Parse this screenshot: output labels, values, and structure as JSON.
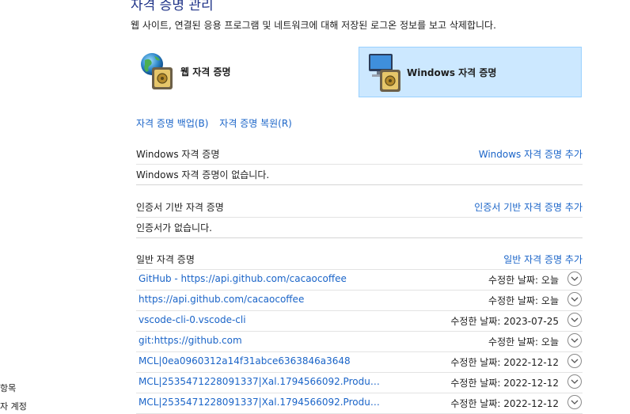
{
  "page": {
    "title": "자격 증명 관리",
    "description": "웹 사이트, 연결된 응용 프로그램 및 네트워크에 대해 저장된 로그온 정보를 보고 삭제합니다."
  },
  "tiles": {
    "web": {
      "label": "웹 자격 증명",
      "icon": "web-credential-icon"
    },
    "windows": {
      "label": "Windows 자격 증명",
      "icon": "windows-credential-icon",
      "selected": true
    }
  },
  "links": {
    "backup": "자격 증명 백업(B)",
    "restore": "자격 증명 복원(R)"
  },
  "sections": {
    "windows": {
      "heading": "Windows 자격 증명",
      "add": "Windows 자격 증명 추가",
      "empty": "Windows 자격 증명이 없습니다."
    },
    "certificate": {
      "heading": "인증서 기반 자격 증명",
      "add": "인증서 기반 자격 증명 추가",
      "empty": "인증서가 없습니다."
    },
    "generic": {
      "heading": "일반 자격 증명",
      "add": "일반 자격 증명 추가"
    }
  },
  "credentials": [
    {
      "name": "GitHub - https://api.github.com/cacaocoffee",
      "modified": "수정한 날짜:  오늘"
    },
    {
      "name": "https://api.github.com/cacaocoffee",
      "modified": "수정한 날짜:  오늘"
    },
    {
      "name": "vscode-cli-0.vscode-cli",
      "modified": "수정한 날짜:  2023-07-25"
    },
    {
      "name": "git:https://github.com",
      "modified": "수정한 날짜:  오늘"
    },
    {
      "name": "MCL|0ea0960312a14f31abce6363846a3648",
      "modified": "수정한 날짜:  2022-12-12"
    },
    {
      "name": "MCL|2535471228091337|Xal.1794566092.Productio...",
      "modified": "수정한 날짜:  2022-12-12"
    },
    {
      "name": "MCL|2535471228091337|Xal.1794566092.Productio...",
      "modified": "수정한 날짜:  2022-12-12"
    }
  ],
  "sidebar": {
    "item1": "항목",
    "item2": "자 계정"
  }
}
